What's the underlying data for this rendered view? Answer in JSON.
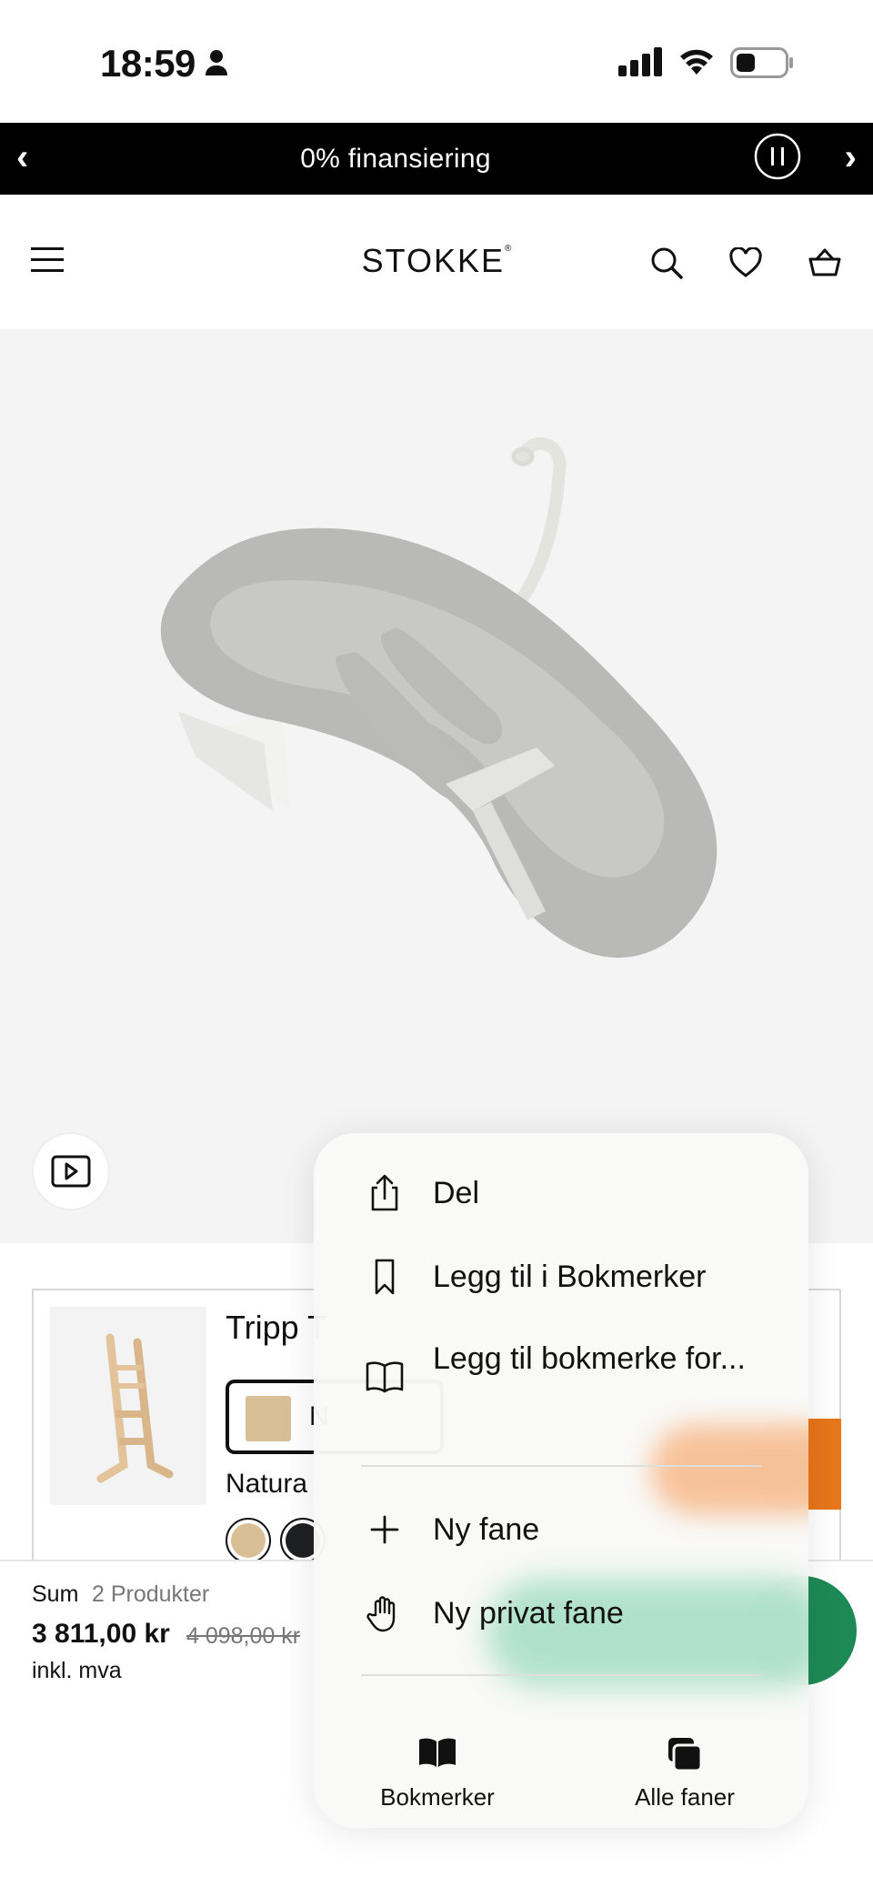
{
  "status_bar": {
    "time": "18:59"
  },
  "promo": {
    "prev_glyph": "‹",
    "text": "0% finansiering",
    "next_glyph": "›"
  },
  "header": {
    "logo": "STOKKE",
    "logo_mark": "®"
  },
  "product": {
    "name": "Tripp T",
    "selected_color_initial": "N",
    "color_label": "Natura",
    "swatch_colors": [
      "#d9bf96",
      "#1f2022"
    ]
  },
  "summary": {
    "label": "Sum",
    "count": "2 Produkter",
    "price": "3 811,00 kr",
    "old_price": "4 098,00 kr",
    "vat": "inkl. mva"
  },
  "context_menu": {
    "items": [
      {
        "label": "Del",
        "icon": "share-icon"
      },
      {
        "label": "Legg til i Bokmerker",
        "icon": "bookmark-icon"
      },
      {
        "label": "Legg til bokmerke for...",
        "icon": "book-open-icon"
      },
      {
        "label": "Ny fane",
        "icon": "plus-icon"
      },
      {
        "label": "Ny privat fane",
        "icon": "hand-icon"
      }
    ],
    "bottom": [
      {
        "label": "Bokmerker",
        "icon": "bookmarks-book-icon"
      },
      {
        "label": "Alle faner",
        "icon": "tabs-icon"
      }
    ]
  },
  "colors": {
    "promo_bg": "#000000",
    "chat_orange": "#e8761a",
    "cart_green": "#1d8a55"
  }
}
